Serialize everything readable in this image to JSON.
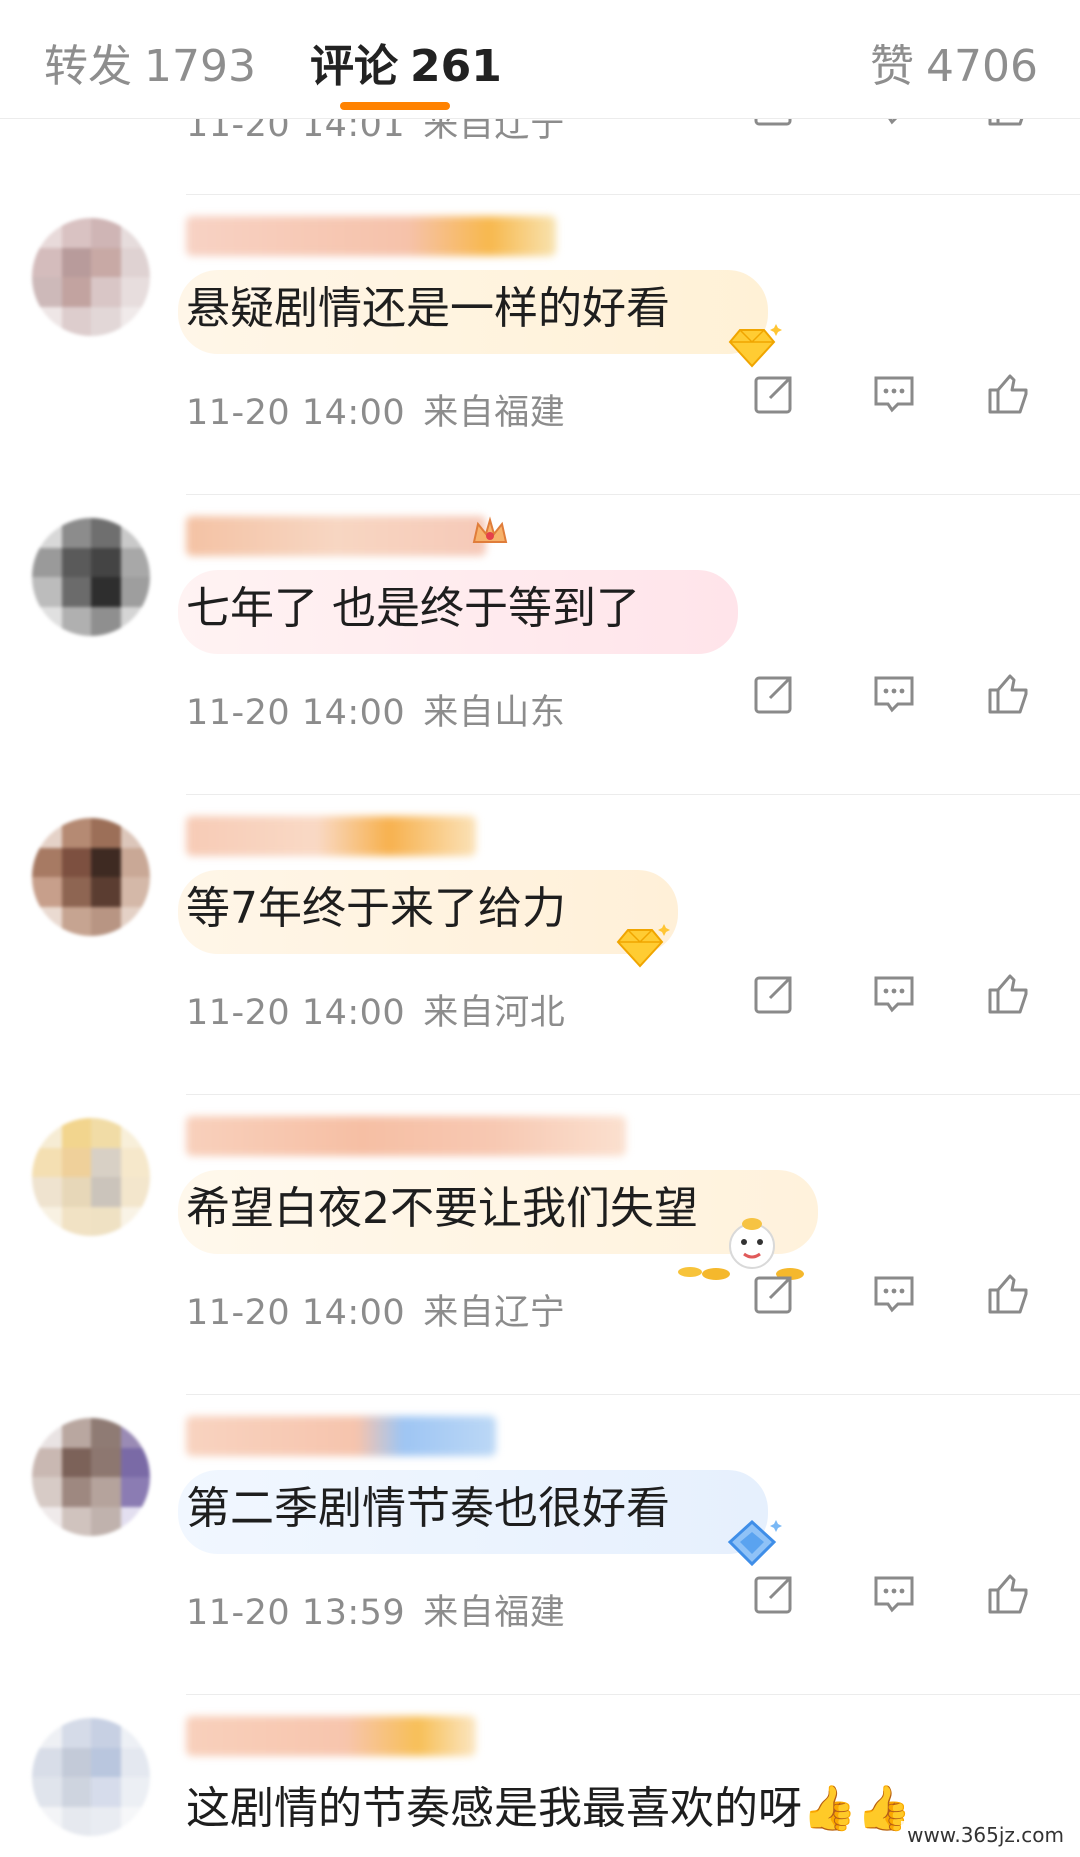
{
  "tabs": {
    "repost": {
      "label": "转发",
      "count": "1793"
    },
    "comments": {
      "label": "评论",
      "count": "261"
    },
    "likes": {
      "label": "赞",
      "count": "4706"
    }
  },
  "top_meta": {
    "time": "11-20 14:01",
    "location": "来自辽宁"
  },
  "comments": [
    {
      "text": "悬疑剧情还是一样的好看",
      "time": "11-20 14:00",
      "location": "来自福建"
    },
    {
      "text": "七年了 也是终于等到了",
      "time": "11-20 14:00",
      "location": "来自山东"
    },
    {
      "text": "等7年终于来了给力",
      "time": "11-20 14:00",
      "location": "来自河北"
    },
    {
      "text": "希望白夜2不要让我们失望",
      "time": "11-20 14:00",
      "location": "来自辽宁"
    },
    {
      "text": "第二季剧情节奏也很好看",
      "time": "11-20 13:59",
      "location": "来自福建"
    },
    {
      "text": "这剧情的节奏感是我最喜欢的呀👍👍",
      "time": "",
      "location": ""
    }
  ],
  "icons": {
    "share": "share-icon",
    "reply": "reply-icon",
    "like": "like-icon"
  },
  "colors": {
    "accent": "#ff8200",
    "meta_text": "#8c8c8c",
    "icon": "#8a8a8a"
  },
  "watermark": "www.365jz.com"
}
